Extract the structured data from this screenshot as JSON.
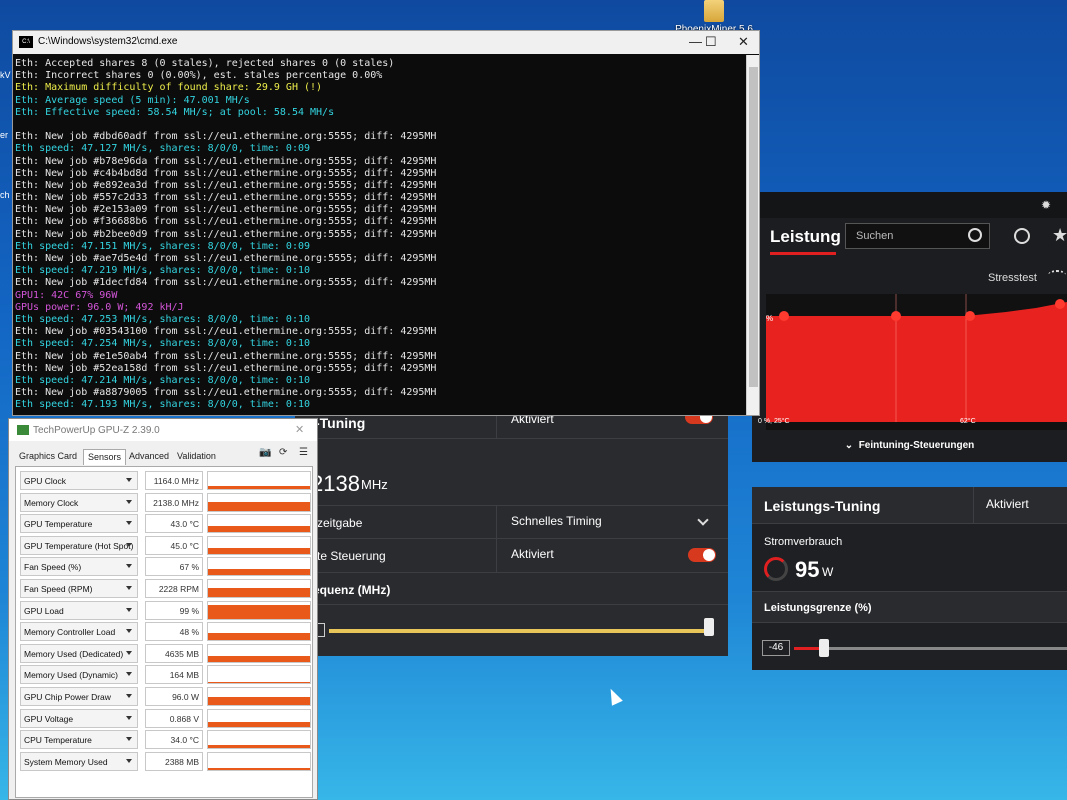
{
  "desktop": {
    "icon_label": "PhoenixMiner 5.6",
    "left_edge_labels": [
      "kV",
      "er",
      "ch"
    ]
  },
  "cmd": {
    "title": "C:\\Windows\\system32\\cmd.exe",
    "icon_text": "C:\\",
    "controls": {
      "minimize": "—",
      "maximize": "☐",
      "close": "✕"
    },
    "lines": [
      {
        "text": "Eth: Accepted shares 8 (0 stales), rejected shares 0 (0 stales)",
        "color": "w"
      },
      {
        "text": "Eth: Incorrect shares 0 (0.00%), est. stales percentage 0.00%",
        "color": "w"
      },
      {
        "text": "Eth: Maximum difficulty of found share: 29.9 GH (!)",
        "color": "y"
      },
      {
        "text": "Eth: Average speed (5 min): 47.001 MH/s",
        "color": "c"
      },
      {
        "text": "Eth: Effective speed: 58.54 MH/s; at pool: 58.54 MH/s",
        "color": "c"
      },
      {
        "text": "",
        "color": "w"
      },
      {
        "text": "Eth: New job #dbd60adf from ssl://eu1.ethermine.org:5555; diff: 4295MH",
        "color": "w"
      },
      {
        "text": "Eth speed: 47.127 MH/s, shares: 8/0/0, time: 0:09",
        "color": "c"
      },
      {
        "text": "Eth: New job #b78e96da from ssl://eu1.ethermine.org:5555; diff: 4295MH",
        "color": "w"
      },
      {
        "text": "Eth: New job #c4b4bd8d from ssl://eu1.ethermine.org:5555; diff: 4295MH",
        "color": "w"
      },
      {
        "text": "Eth: New job #e892ea3d from ssl://eu1.ethermine.org:5555; diff: 4295MH",
        "color": "w"
      },
      {
        "text": "Eth: New job #557c2d33 from ssl://eu1.ethermine.org:5555; diff: 4295MH",
        "color": "w"
      },
      {
        "text": "Eth: New job #2e153a09 from ssl://eu1.ethermine.org:5555; diff: 4295MH",
        "color": "w"
      },
      {
        "text": "Eth: New job #f36688b6 from ssl://eu1.ethermine.org:5555; diff: 4295MH",
        "color": "w"
      },
      {
        "text": "Eth: New job #b2bee0d9 from ssl://eu1.ethermine.org:5555; diff: 4295MH",
        "color": "w"
      },
      {
        "text": "Eth speed: 47.151 MH/s, shares: 8/0/0, time: 0:09",
        "color": "c"
      },
      {
        "text": "Eth: New job #ae7d5e4d from ssl://eu1.ethermine.org:5555; diff: 4295MH",
        "color": "w"
      },
      {
        "text": "Eth speed: 47.219 MH/s, shares: 8/0/0, time: 0:10",
        "color": "c"
      },
      {
        "text": "Eth: New job #1decfd84 from ssl://eu1.ethermine.org:5555; diff: 4295MH",
        "color": "w"
      },
      {
        "text": "GPU1: 42C 67% 96W",
        "color": "m"
      },
      {
        "text": "GPUs power: 96.0 W; 492 kH/J",
        "color": "m"
      },
      {
        "text": "Eth speed: 47.253 MH/s, shares: 8/0/0, time: 0:10",
        "color": "c"
      },
      {
        "text": "Eth: New job #03543100 from ssl://eu1.ethermine.org:5555; diff: 4295MH",
        "color": "w"
      },
      {
        "text": "Eth speed: 47.254 MH/s, shares: 8/0/0, time: 0:10",
        "color": "c"
      },
      {
        "text": "Eth: New job #e1e50ab4 from ssl://eu1.ethermine.org:5555; diff: 4295MH",
        "color": "w"
      },
      {
        "text": "Eth: New job #52ea158d from ssl://eu1.ethermine.org:5555; diff: 4295MH",
        "color": "w"
      },
      {
        "text": "Eth speed: 47.214 MH/s, shares: 8/0/0, time: 0:10",
        "color": "c"
      },
      {
        "text": "Eth: New job #a8879005 from ssl://eu1.ethermine.org:5555; diff: 4295MH",
        "color": "w"
      },
      {
        "text": "Eth speed: 47.193 MH/s, shares: 8/0/0, time: 0:10",
        "color": "c"
      }
    ]
  },
  "amd": {
    "performance": {
      "title": "Leistung",
      "search_placeholder": "Suchen",
      "stress_label": "Stresstest",
      "chart_pct_label": "%",
      "axis_left": "0 %, 25°C",
      "axis_mid": "62°C",
      "fine_tuning_label": "Feintuning-Steuerungen"
    },
    "memory_panel": {
      "row1_left": "-Tuning",
      "row1_right": "Aktiviert",
      "freq_value": "2138",
      "freq_unit": "MHz",
      "row3_left": "rzeitgabe",
      "row3_right": "Schnelles Timing",
      "row4_left": "rte Steuerung",
      "row4_right": "Aktiviert",
      "row5_left": "equenz (MHz)",
      "slider_fraction": 1.0
    },
    "power_tuning": {
      "title": "Leistungs-Tuning",
      "status": "Aktiviert",
      "consumption_label": "Stromverbrauch",
      "consumption_value": "95",
      "consumption_unit": "W",
      "limit_label": "Leistungsgrenze (%)",
      "limit_value": "-46"
    },
    "colors": {
      "accent_red": "#e02020",
      "panel": "#2a2b2f",
      "slider_yellow": "#e8c65a"
    }
  },
  "gpuz": {
    "title": "TechPowerUp GPU-Z 2.39.0",
    "close_glyph": "✕",
    "tabs": [
      "Graphics Card",
      "Sensors",
      "Advanced",
      "Validation"
    ],
    "active_tab": "Sensors",
    "toolbar_icons": [
      "camera-icon",
      "refresh-icon",
      "menu-icon"
    ],
    "sensors": [
      {
        "name": "GPU Clock",
        "value": "1164.0 MHz",
        "level": 0.15
      },
      {
        "name": "Memory Clock",
        "value": "2138.0 MHz",
        "level": 0.55
      },
      {
        "name": "GPU Temperature",
        "value": "43.0 °C",
        "level": 0.35
      },
      {
        "name": "GPU Temperature (Hot Spot)",
        "value": "45.0 °C",
        "level": 0.35
      },
      {
        "name": "Fan Speed (%)",
        "value": "67 %",
        "level": 0.35
      },
      {
        "name": "Fan Speed (RPM)",
        "value": "2228 RPM",
        "level": 0.55
      },
      {
        "name": "GPU Load",
        "value": "99 %",
        "level": 0.85
      },
      {
        "name": "Memory Controller Load",
        "value": "48 %",
        "level": 0.4
      },
      {
        "name": "Memory Used (Dedicated)",
        "value": "4635 MB",
        "level": 0.35
      },
      {
        "name": "Memory Used (Dynamic)",
        "value": "164 MB",
        "level": 0.05
      },
      {
        "name": "GPU Chip Power Draw",
        "value": "96.0 W",
        "level": 0.45
      },
      {
        "name": "GPU Voltage",
        "value": "0.868 V",
        "level": 0.3
      },
      {
        "name": "CPU Temperature",
        "value": "34.0 °C",
        "level": 0.2
      },
      {
        "name": "System Memory Used",
        "value": "2388 MB",
        "level": 0.1
      }
    ]
  }
}
